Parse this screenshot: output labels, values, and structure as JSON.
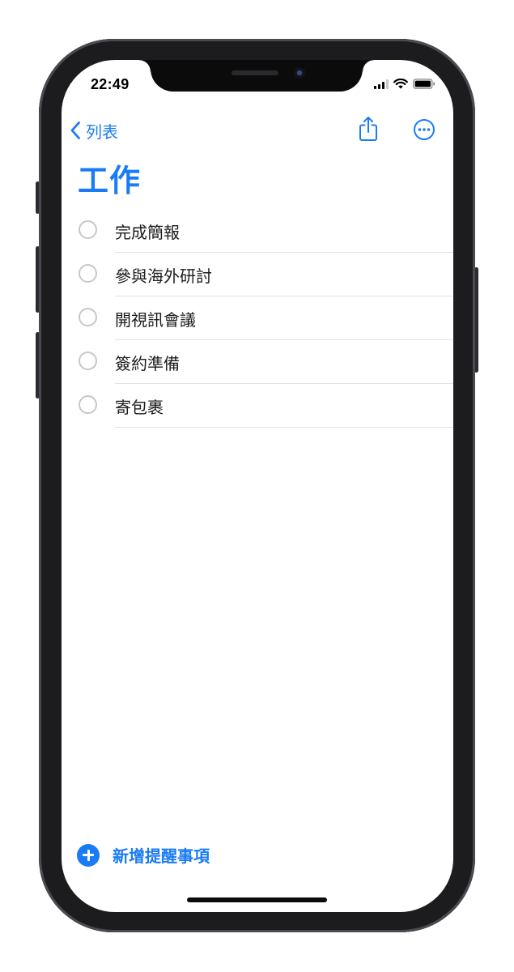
{
  "status_bar": {
    "time": "22:49",
    "signal_icon": "cellular-signal-icon",
    "wifi_icon": "wifi-icon",
    "battery_icon": "battery-icon"
  },
  "navbar": {
    "back_label": "列表",
    "back_icon": "chevron-left-icon",
    "share_icon": "share-icon",
    "more_icon": "ellipsis-circle-icon"
  },
  "list_title": "工作",
  "reminders": [
    {
      "title": "完成簡報"
    },
    {
      "title": "參與海外研討"
    },
    {
      "title": "開視訊會議"
    },
    {
      "title": "簽約準備"
    },
    {
      "title": "寄包裹"
    }
  ],
  "add_button": {
    "label": "新增提醒事項",
    "icon": "plus-circle-icon"
  },
  "colors": {
    "accent": "#1a7cf5",
    "text": "#1c1c1e",
    "checkbox_border": "#c7c7cc",
    "separator": "#e2e2e6",
    "device_frame": "#1c1c1f"
  }
}
